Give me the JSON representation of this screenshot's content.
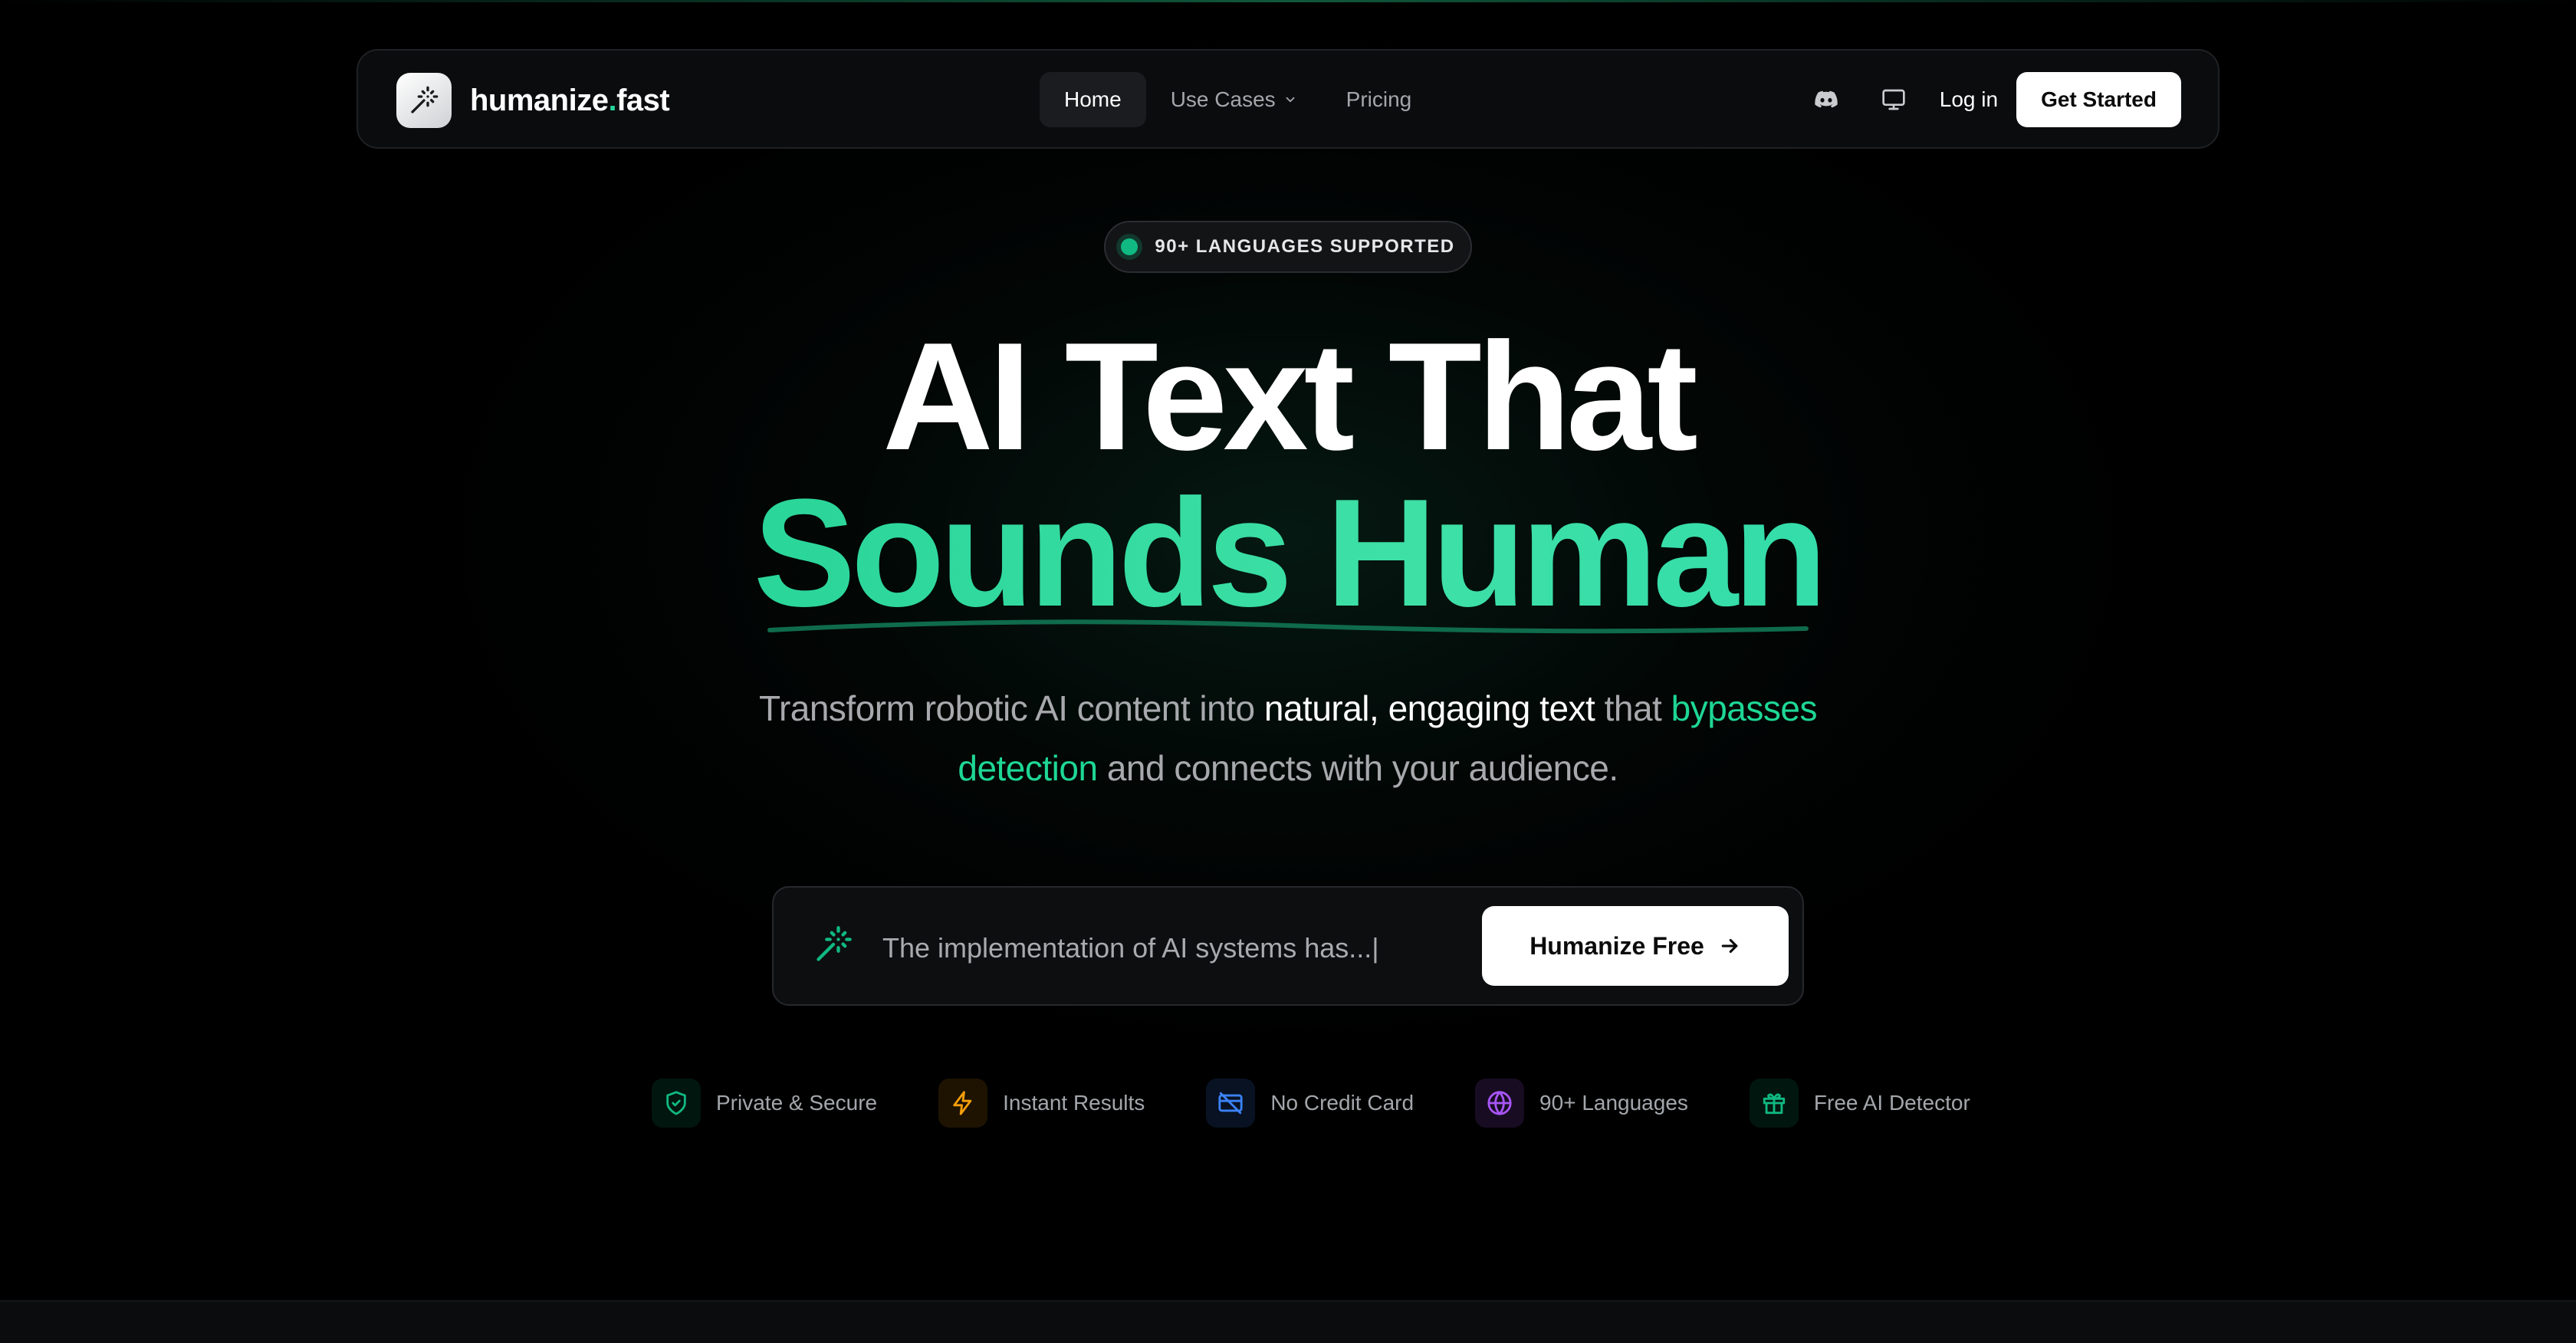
{
  "nav": {
    "brand_main": "humanize",
    "brand_dot": ".",
    "brand_tld": "fast",
    "links": [
      {
        "label": "Home",
        "active": true
      },
      {
        "label": "Use Cases",
        "has_dropdown": true
      },
      {
        "label": "Pricing"
      }
    ],
    "login_label": "Log in",
    "cta_label": "Get Started"
  },
  "badge": {
    "text": "90+ LANGUAGES SUPPORTED"
  },
  "hero": {
    "line1": "AI Text That",
    "line2": "Sounds Human",
    "subtitle": {
      "part1": "Transform robotic AI content into ",
      "highlight1": "natural, engaging text",
      "part2": " that ",
      "highlight2a": "bypasses",
      "highlight2b": "detection",
      "part3": " and connects with your audience."
    }
  },
  "input": {
    "value": "The implementation of AI systems has...|",
    "button_label": "Humanize Free"
  },
  "features": [
    {
      "label": "Private & Secure",
      "icon": "shield-icon",
      "color": "#10b981"
    },
    {
      "label": "Instant Results",
      "icon": "lightning-icon",
      "color": "#f59e0b"
    },
    {
      "label": "No Credit Card",
      "icon": "no-credit-card-icon",
      "color": "#3b82f6"
    },
    {
      "label": "90+ Languages",
      "icon": "globe-icon",
      "color": "#a855f7"
    },
    {
      "label": "Free AI Detector",
      "icon": "gift-icon",
      "color": "#10b981"
    }
  ],
  "colors": {
    "accent": "#10b981",
    "accent_light": "#3ee0a6",
    "background": "#000000"
  }
}
